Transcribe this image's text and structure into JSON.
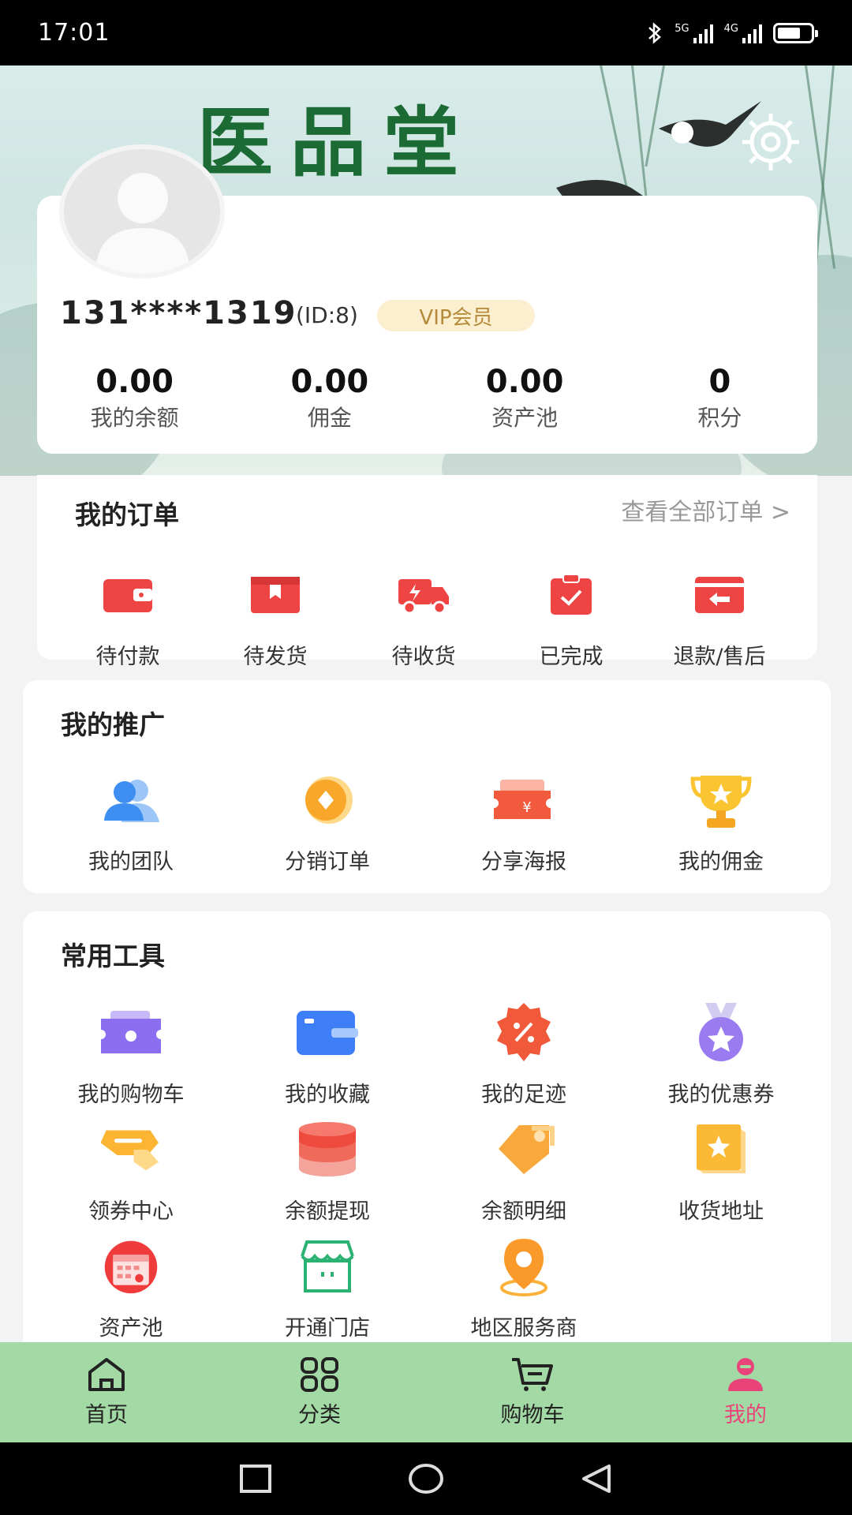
{
  "status_bar": {
    "time": "17:01",
    "signal1_label": "5G",
    "signal2_label": "4G",
    "battery_level": 0.7
  },
  "header": {
    "brand": "医品堂"
  },
  "profile": {
    "phone": "131****1319",
    "id_text": "(ID:8)",
    "vip_label": "VIP会员",
    "stats": [
      {
        "value": "0.00",
        "label": "我的余额"
      },
      {
        "value": "0.00",
        "label": "佣金"
      },
      {
        "value": "0.00",
        "label": "资产池"
      },
      {
        "value": "0",
        "label": "积分"
      }
    ]
  },
  "orders": {
    "title": "我的订单",
    "view_all": "查看全部订单 >",
    "items": [
      {
        "label": "待付款",
        "icon": "wallet-icon"
      },
      {
        "label": "待发货",
        "icon": "box-icon"
      },
      {
        "label": "待收货",
        "icon": "truck-icon"
      },
      {
        "label": "已完成",
        "icon": "clipboard-check-icon"
      },
      {
        "label": "退款/售后",
        "icon": "refund-icon"
      }
    ]
  },
  "promotion": {
    "title": "我的推广",
    "items": [
      {
        "label": "我的团队",
        "icon": "team-icon"
      },
      {
        "label": "分销订单",
        "icon": "coin-icon"
      },
      {
        "label": "分享海报",
        "icon": "ticket-icon"
      },
      {
        "label": "我的佣金",
        "icon": "trophy-icon"
      }
    ]
  },
  "tools": {
    "title": "常用工具",
    "items": [
      {
        "label": "我的购物车",
        "icon": "ticket-purple-icon"
      },
      {
        "label": "我的收藏",
        "icon": "wallet-blue-icon"
      },
      {
        "label": "我的足迹",
        "icon": "discount-badge-icon"
      },
      {
        "label": "我的优惠券",
        "icon": "medal-icon"
      },
      {
        "label": "领券中心",
        "icon": "coupon-icon"
      },
      {
        "label": "余额提现",
        "icon": "coin-stack-icon"
      },
      {
        "label": "余额明细",
        "icon": "tag-icon"
      },
      {
        "label": "收货地址",
        "icon": "star-card-icon"
      },
      {
        "label": "资产池",
        "icon": "calendar-icon"
      },
      {
        "label": "开通门店",
        "icon": "store-icon"
      },
      {
        "label": "地区服务商",
        "icon": "location-pin-icon"
      }
    ]
  },
  "bottom_nav": {
    "items": [
      {
        "label": "首页",
        "icon": "home-icon"
      },
      {
        "label": "分类",
        "icon": "grid-icon"
      },
      {
        "label": "购物车",
        "icon": "cart-icon"
      },
      {
        "label": "我的",
        "icon": "user-icon",
        "active": true
      }
    ]
  },
  "colors": {
    "nav_bg": "#a3d9a4",
    "active": "#e8447a",
    "brand_green": "#1c6b35",
    "order_red": "#ef4444"
  }
}
